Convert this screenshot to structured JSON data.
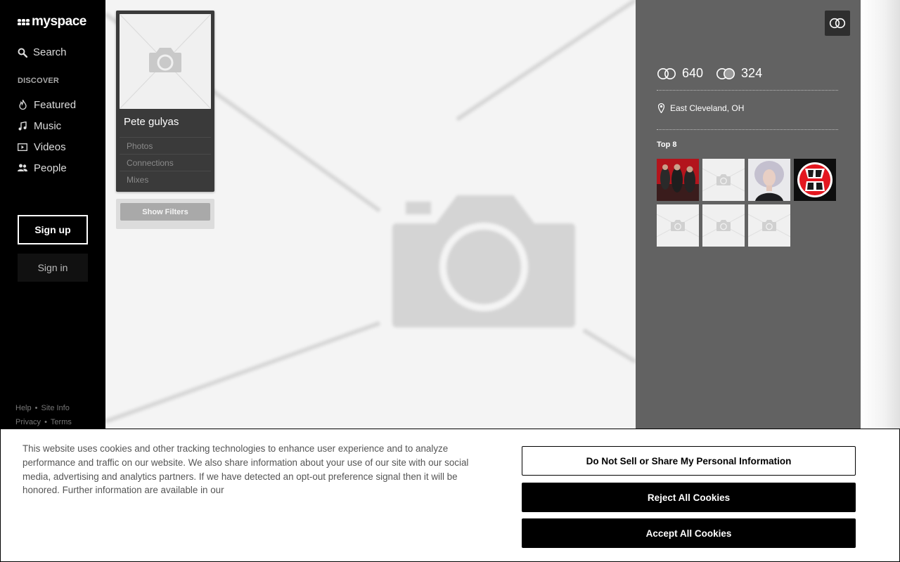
{
  "brand": {
    "logo_text": "myspace"
  },
  "sidebar": {
    "search_label": "Search",
    "discover_label": "DISCOVER",
    "nav": [
      {
        "label": "Featured",
        "icon": "flame-icon"
      },
      {
        "label": "Music",
        "icon": "music-note-icon"
      },
      {
        "label": "Videos",
        "icon": "video-icon"
      },
      {
        "label": "People",
        "icon": "people-icon"
      }
    ],
    "signup_label": "Sign up",
    "signin_label": "Sign in",
    "footer": {
      "help": "Help",
      "site_info": "Site Info",
      "privacy": "Privacy",
      "terms": "Terms",
      "separator": "•"
    }
  },
  "profile": {
    "name": "Pete gulyas",
    "links": [
      "Photos",
      "Connections",
      "Mixes"
    ],
    "filters_label": "Show Filters"
  },
  "panel": {
    "connections_count": "640",
    "mutual_count": "324",
    "location": "East Cleveland, OH",
    "top8_label": "Top 8",
    "top8": [
      {
        "name": "band-photo",
        "icon": "band-photo"
      },
      {
        "name": "placeholder",
        "icon": "camera-icon"
      },
      {
        "name": "woman-portrait",
        "icon": "portrait"
      },
      {
        "name": "grog-shop-logo",
        "icon": "grog-shop-logo"
      },
      {
        "name": "placeholder",
        "icon": "camera-icon"
      },
      {
        "name": "placeholder",
        "icon": "camera-icon"
      },
      {
        "name": "placeholder",
        "icon": "camera-icon"
      }
    ]
  },
  "cookie": {
    "text": "This website uses cookies and other tracking technologies to enhance user experience and to analyze performance and traffic on our website. We also share information about your use of our site with our social media, advertising and analytics partners. If we have detected an opt-out preference signal then it will be honored. Further information are available in our",
    "do_not_sell_label": "Do Not Sell or Share My Personal Information",
    "reject_label": "Reject All Cookies",
    "accept_label": "Accept All Cookies"
  },
  "colors": {
    "sidebar_bg": "#000000",
    "panel_bg": "#626262",
    "main_bg": "#f4f4f4"
  }
}
